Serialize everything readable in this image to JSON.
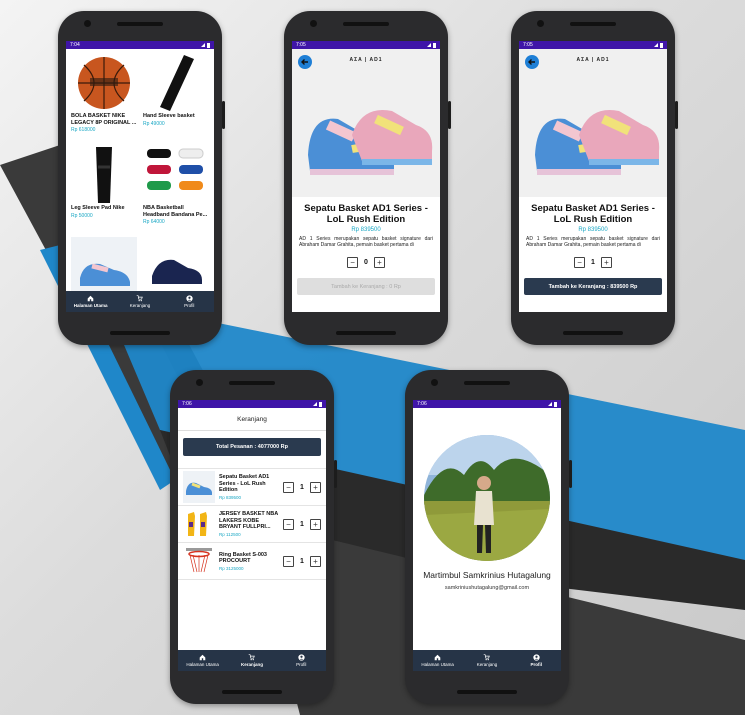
{
  "colors": {
    "accent": "#1aa7c4",
    "status_bar": "#3f15a8",
    "nav": "#263447",
    "button": "#2a3a4f"
  },
  "nav": {
    "home_label": "Halaman Utama",
    "cart_label": "Keranjang",
    "profile_label": "Profil"
  },
  "screen1": {
    "time": "7:04",
    "products": [
      {
        "name": "BOLA BASKET NIKE LEGACY 8P ORIGINAL ...",
        "price": "Rp 618000",
        "icon": "basketball"
      },
      {
        "name": "Hand Sleeve basket",
        "price": "Rp 49000",
        "icon": "arm-sleeve"
      },
      {
        "name": "Leg Sleeve Pad Nike",
        "price": "Rp 50000",
        "icon": "leg-sleeve"
      },
      {
        "name": "NBA Basketball Headband Bandana Pe...",
        "price": "Rp 64000",
        "icon": "headbands"
      }
    ]
  },
  "screen2": {
    "time": "7:05",
    "logo": "AΣA | AD1",
    "title": "Sepatu Basket AD1 Series - LoL Rush Edition",
    "price": "Rp 839500",
    "description": "AD 1 Series merupakan sepatu basket signature dari Abraham Damar Grahita, pemain basket pertama di",
    "quantity": "0",
    "add_button": "Tambah ke Keranjang : 0 Rp"
  },
  "screen3": {
    "time": "7:05",
    "logo": "AΣA | AD1",
    "title": "Sepatu Basket AD1 Series - LoL Rush Edition",
    "price": "Rp 839500",
    "description": "AD 1 Series merupakan sepatu basket signature dari Abraham Damar Grahita, pemain basket pertama di",
    "quantity": "1",
    "add_button": "Tambah ke Keranjang : 839500 Rp"
  },
  "screen4": {
    "time": "7:06",
    "header": "Keranjang",
    "total": "Total Pesanan : 4077000 Rp",
    "items": [
      {
        "name": "Sepatu Basket AD1 Series - LoL Rush Edition",
        "price": "Rp 839500",
        "qty": "1",
        "icon": "shoe"
      },
      {
        "name": "JERSEY BASKET NBA LAKERS KOBE BRYANT FULLPRI...",
        "price": "Rp 112500",
        "qty": "1",
        "icon": "jersey"
      },
      {
        "name": "Ring Basket S-003 PROCOURT",
        "price": "Rp 3125000",
        "qty": "1",
        "icon": "basket-ring"
      }
    ]
  },
  "screen5": {
    "time": "7:06",
    "name": "Martimbul Samkrinius Hutagalung",
    "email": "samkriniushutagalung@gmail.com"
  }
}
